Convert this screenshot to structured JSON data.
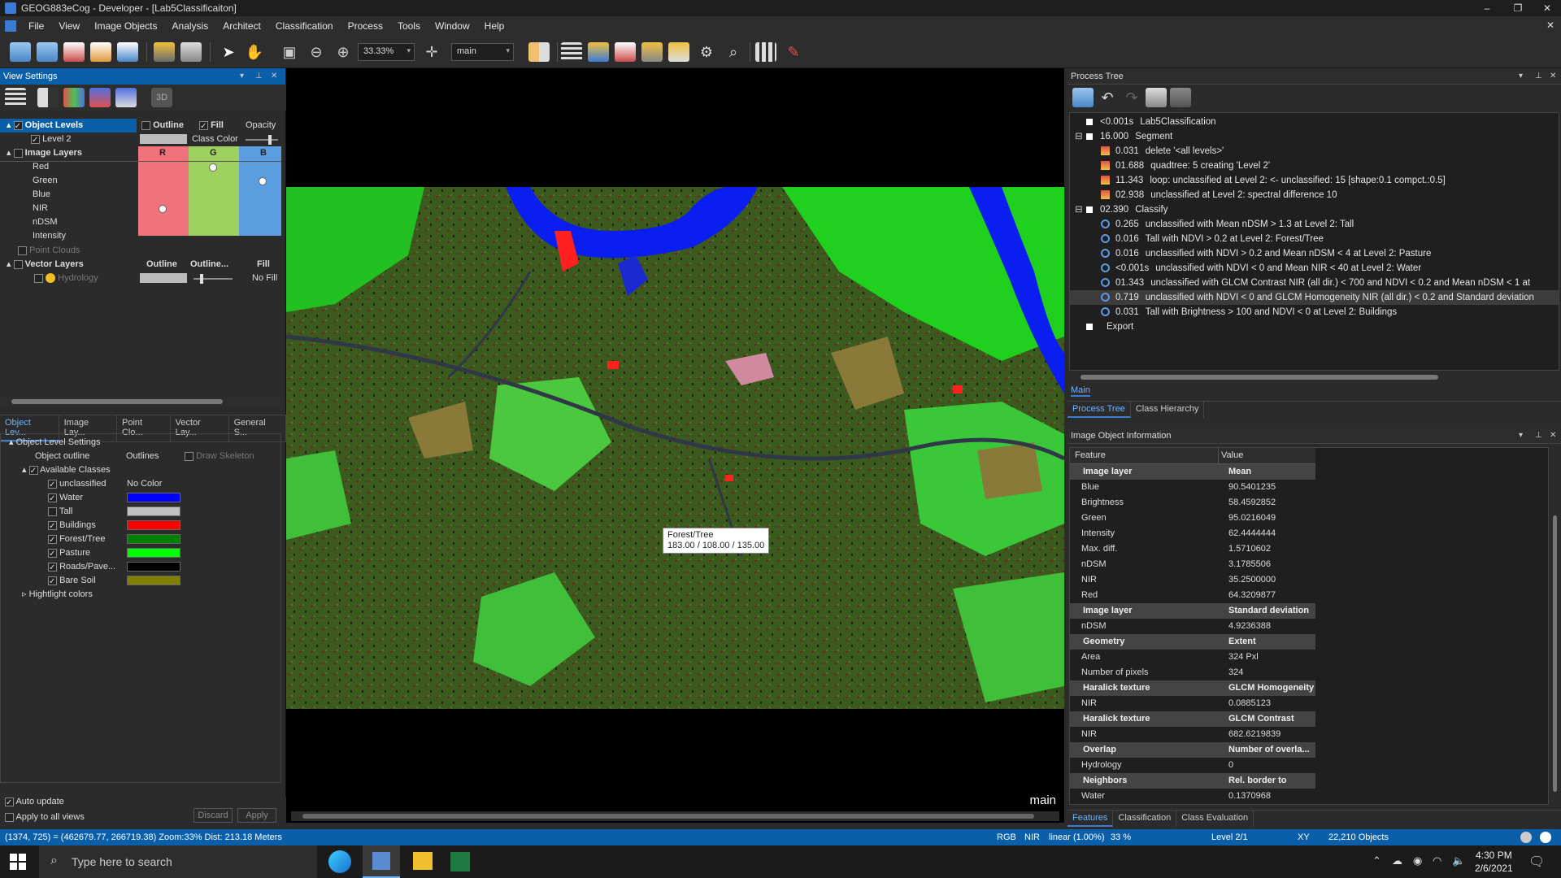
{
  "window": {
    "title": "GEOG883eCog - Developer - [Lab5Classificaiton]",
    "minimize": "–",
    "restore": "❐",
    "close": "✕",
    "doc_close": "✕"
  },
  "menu": [
    "File",
    "View",
    "Image Objects",
    "Analysis",
    "Architect",
    "Classification",
    "Process",
    "Tools",
    "Window",
    "Help"
  ],
  "toolbar": {
    "zoom": "33.33%",
    "view_name": "main"
  },
  "view_settings": {
    "title": "View Settings",
    "btn_3d": "3D",
    "object_levels": "Object Levels",
    "col_outline": "Outline",
    "col_fill": "Fill",
    "col_opacity": "Opacity",
    "level2": "Level 2",
    "class_color": "Class Color",
    "image_layers": "Image Layers",
    "col_r": "R",
    "col_g": "G",
    "col_b": "B",
    "layers": [
      "Red",
      "Green",
      "Blue",
      "NIR",
      "nDSM",
      "Intensity"
    ],
    "point_clouds": "Point Clouds",
    "vector_layers": "Vector Layers",
    "vec_outline": "Outline",
    "vec_outline2": "Outline...",
    "vec_fill": "Fill",
    "hydrology": "Hydrology",
    "no_fill": "No Fill"
  },
  "vs_tabs": [
    "Object Lev...",
    "Image Lay...",
    "Point Clo...",
    "Vector Lay...",
    "General S..."
  ],
  "object_level_settings": {
    "title": "Object Level Settings",
    "object_outline": "Object outline",
    "outlines": "Outlines",
    "draw_skeleton": "Draw Skeleton",
    "available_classes": "Available Classes",
    "classes": [
      {
        "name": "unclassified",
        "color": "",
        "label": "No Color",
        "checked": true
      },
      {
        "name": "Water",
        "color": "#0000ff",
        "checked": true
      },
      {
        "name": "Tall",
        "color": "#c0c0c0",
        "checked": false
      },
      {
        "name": "Buildings",
        "color": "#ff0000",
        "checked": true
      },
      {
        "name": "Forest/Tree",
        "color": "#008000",
        "checked": true
      },
      {
        "name": "Pasture",
        "color": "#00ff00",
        "checked": true
      },
      {
        "name": "Roads/Pave...",
        "color": "#000000",
        "checked": true
      },
      {
        "name": "Bare Soil",
        "color": "#808000",
        "checked": true
      }
    ],
    "highlight": "Hightlight colors",
    "auto_update": "Auto update",
    "apply_all": "Apply to all views",
    "discard": "Discard",
    "apply": "Apply"
  },
  "map": {
    "tooltip_class": "Forest/Tree",
    "tooltip_values": "183.00 / 108.00 / 135.00",
    "view_label": "main"
  },
  "process_tree": {
    "title": "Process Tree",
    "rows": [
      {
        "time": "<0.001s",
        "text": "Lab5Classification",
        "level": 0
      },
      {
        "time": "16.000",
        "text": "Segment",
        "level": 0,
        "toggle": "⊟"
      },
      {
        "time": "0.031",
        "text": "delete '<all levels>'",
        "level": 1
      },
      {
        "time": "01.688",
        "text": "quadtree: 5 creating 'Level 2'",
        "level": 1
      },
      {
        "time": "11.343",
        "text": "loop: unclassified at  Level 2: <- unclassified: 15 [shape:0.1 compct.:0.5]",
        "level": 1
      },
      {
        "time": "02.938",
        "text": "unclassified at  Level 2: spectral difference 10",
        "level": 1
      },
      {
        "time": "02.390",
        "text": "Classify",
        "level": 0,
        "toggle": "⊟"
      },
      {
        "time": "0.265",
        "text": "unclassified with Mean nDSM > 1.3  at  Level 2: Tall",
        "level": 1,
        "circle": true
      },
      {
        "time": "0.016",
        "text": "Tall with NDVI > 0.2  at  Level 2: Forest/Tree",
        "level": 1,
        "circle": true
      },
      {
        "time": "0.016",
        "text": "unclassified with NDVI > 0.2  and Mean nDSM < 4  at  Level 2: Pasture",
        "level": 1,
        "circle": true
      },
      {
        "time": "<0.001s",
        "text": "unclassified with NDVI < 0  and Mean NIR < 40  at  Level 2: Water",
        "level": 1,
        "circle": true
      },
      {
        "time": "01.343",
        "text": "unclassified with GLCM Contrast NIR (all dir.) < 700  and NDVI < 0.2  and Mean nDSM < 1  at",
        "level": 1,
        "circle": true
      },
      {
        "time": "0.719",
        "text": "unclassified with NDVI < 0  and GLCM Homogeneity NIR (all dir.) < 0.2  and Standard deviation",
        "level": 1,
        "circle": true,
        "selected": true
      },
      {
        "time": "0.031",
        "text": "Tall with Brightness > 100  and NDVI < 0  at  Level 2: Buildings",
        "level": 1,
        "circle": true
      },
      {
        "time": "",
        "text": "Export",
        "level": 0
      }
    ],
    "main_tab": "Main",
    "tabs": [
      "Process Tree",
      "Class Hierarchy"
    ]
  },
  "image_object_info": {
    "title": "Image Object Information",
    "col_feature": "Feature",
    "col_value": "Value",
    "rows": [
      {
        "h": true,
        "f": "Image layer",
        "v": "Mean"
      },
      {
        "f": "Blue",
        "v": "90.5401235"
      },
      {
        "f": "Brightness",
        "v": "58.4592852"
      },
      {
        "f": "Green",
        "v": "95.0216049"
      },
      {
        "f": "Intensity",
        "v": "62.4444444"
      },
      {
        "f": "Max. diff.",
        "v": "1.5710602"
      },
      {
        "f": "nDSM",
        "v": "3.1785506"
      },
      {
        "f": "NIR",
        "v": "35.2500000"
      },
      {
        "f": "Red",
        "v": "64.3209877"
      },
      {
        "h": true,
        "f": "Image layer",
        "v": "Standard deviation"
      },
      {
        "f": "nDSM",
        "v": "4.9236388"
      },
      {
        "h": true,
        "f": "Geometry",
        "v": "Extent"
      },
      {
        "f": "Area",
        "v": "324 Pxl"
      },
      {
        "f": "Number of pixels",
        "v": "324"
      },
      {
        "h": true,
        "f": "Haralick texture",
        "v": "GLCM Homogeneity"
      },
      {
        "f": "NIR",
        "v": "0.0885123"
      },
      {
        "h": true,
        "f": "Haralick texture",
        "v": "GLCM Contrast"
      },
      {
        "f": "NIR",
        "v": "682.6219839"
      },
      {
        "h": true,
        "f": "Overlap",
        "v": "Number of overla..."
      },
      {
        "f": "Hydrology",
        "v": "0"
      },
      {
        "h": true,
        "f": "Neighbors",
        "v": "Rel. border to"
      },
      {
        "f": "Water",
        "v": "0.1370968"
      }
    ],
    "tabs": [
      "Features",
      "Classification",
      "Class Evaluation"
    ]
  },
  "status": {
    "coords": "(1374, 725) = (462679.77, 266719.38)  Zoom:33%  Dist: 213.18 Meters",
    "rgb": "RGB",
    "nir": "NIR",
    "linear": "linear (1.00%)",
    "pct": "33 %",
    "level": "Level 2/1",
    "xy": "XY",
    "objects": "22,210 Objects"
  },
  "taskbar": {
    "search": "Type here to search",
    "time": "4:30 PM",
    "date": "2/6/2021"
  }
}
